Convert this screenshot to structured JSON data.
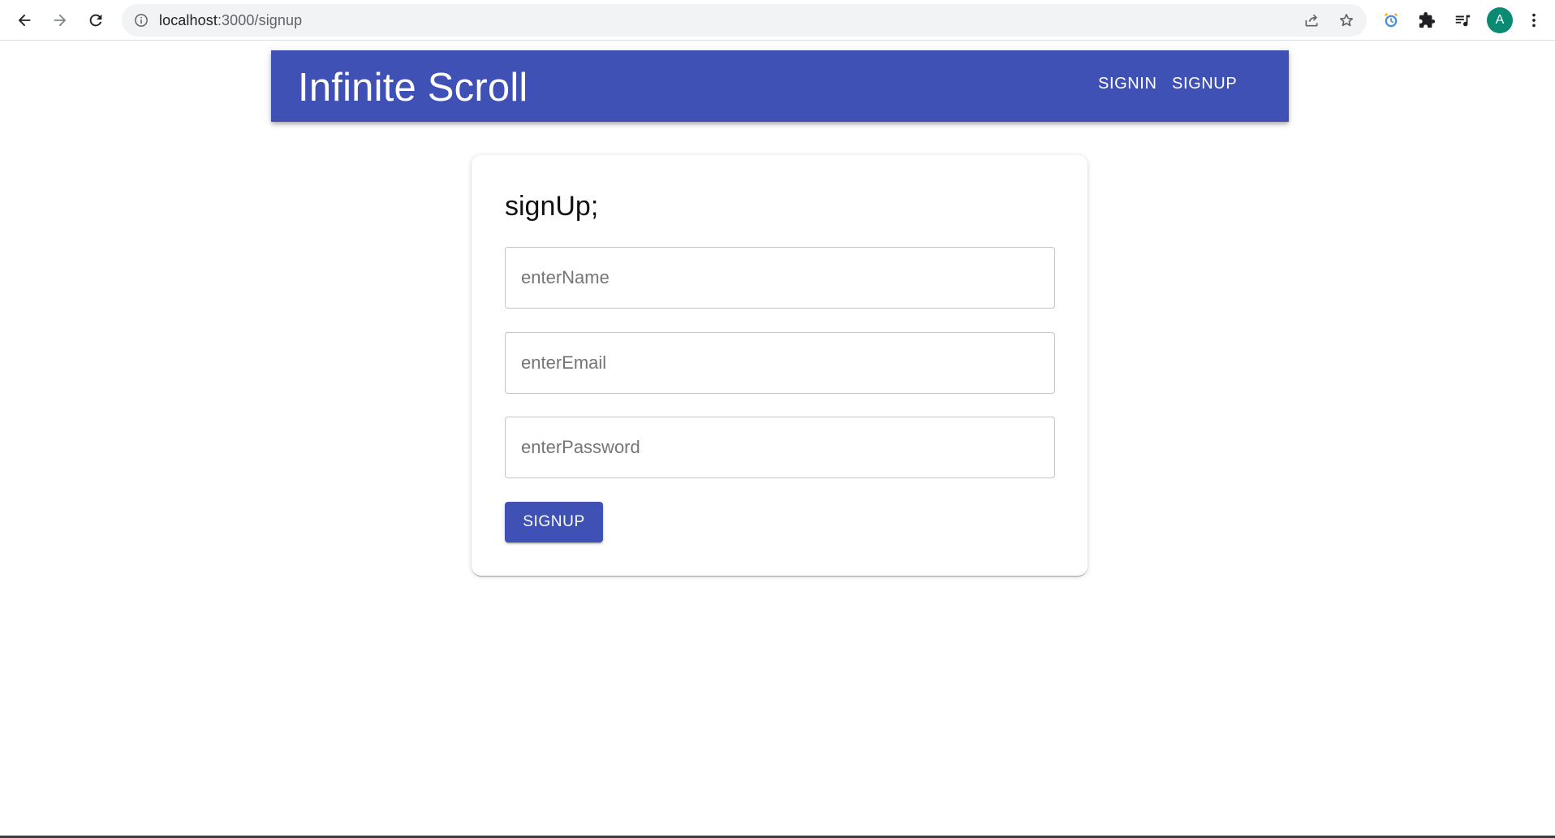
{
  "browser": {
    "url_host": "localhost",
    "url_path": ":3000/signup",
    "avatar_letter": "A"
  },
  "appbar": {
    "title": "Infinite Scroll",
    "links": [
      {
        "label": "SIGNIN"
      },
      {
        "label": "SIGNUP"
      }
    ]
  },
  "form": {
    "heading": "signUp;",
    "name_placeholder": "enterName",
    "email_placeholder": "enterEmail",
    "password_placeholder": "enterPassword",
    "submit_label": "SIGNUP"
  },
  "colors": {
    "primary": "#3f51b5",
    "avatar": "#0a8a72"
  }
}
